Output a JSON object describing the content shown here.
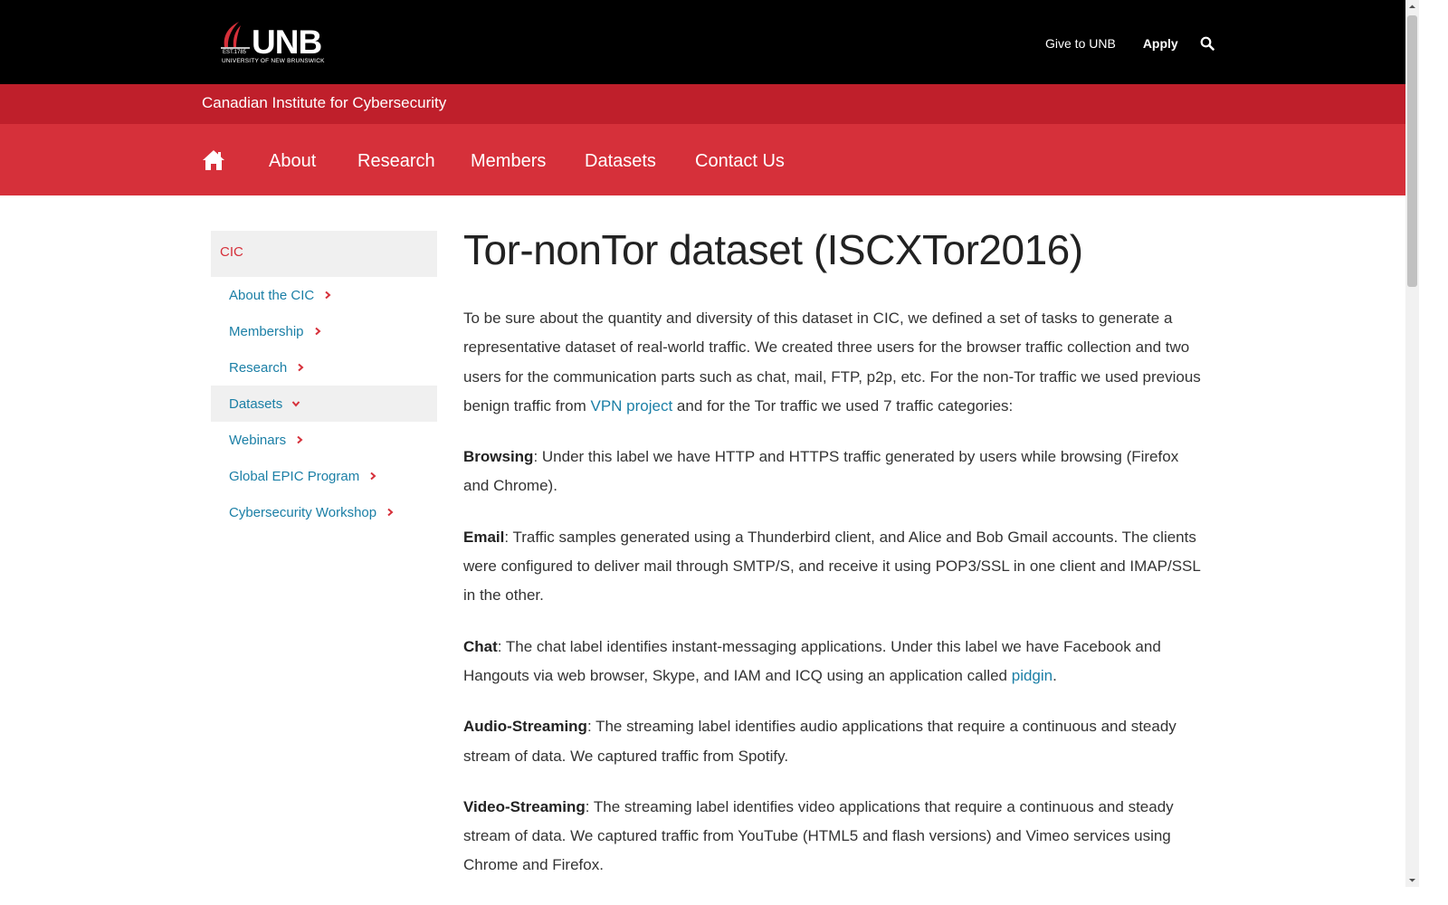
{
  "header": {
    "logo_text": "UNB",
    "logo_est": "EST.1785",
    "logo_sub": "UNIVERSITY OF NEW BRUNSWICK",
    "links": {
      "give": "Give to UNB",
      "apply": "Apply"
    }
  },
  "site": {
    "title": "Canadian Institute for Cybersecurity"
  },
  "nav": {
    "items": [
      {
        "label": "About"
      },
      {
        "label": "Research"
      },
      {
        "label": "Members"
      },
      {
        "label": "Datasets"
      },
      {
        "label": "Contact Us"
      }
    ]
  },
  "sidebar": {
    "heading": "CIC",
    "items": [
      {
        "label": "About the CIC"
      },
      {
        "label": "Membership"
      },
      {
        "label": "Research"
      },
      {
        "label": "Datasets"
      },
      {
        "label": "Webinars"
      },
      {
        "label": "Global EPIC Program"
      },
      {
        "label": "Cybersecurity Workshop"
      }
    ]
  },
  "main": {
    "title": "Tor-nonTor dataset (ISCXTor2016)",
    "intro_a": "To be sure about the quantity and diversity of this dataset in CIC, we defined a set of tasks to generate a representative dataset of real-world traffic. We created three users for the browser traffic collection and two users for the communication parts such as chat, mail, FTP, p2p, etc. For the non-Tor traffic we used previous benign traffic from ",
    "intro_link": "VPN project",
    "intro_b": " and for the Tor traffic we used 7 traffic categories:",
    "browsing_label": "Browsing",
    "browsing_text": ": Under this label we have HTTP and HTTPS traffic generated by users while browsing (Firefox and Chrome).",
    "email_label": "Email",
    "email_text": ": Traffic samples generated using a Thunderbird client, and Alice and Bob Gmail accounts. The clients were configured to deliver mail through SMTP/S, and receive it using POP3/SSL in one client and IMAP/SSL in the other.",
    "chat_label": "Chat",
    "chat_text": ": The chat label identifies instant-messaging applications. Under this label we have Facebook and Hangouts via web browser, Skype, and IAM and ICQ using an application called ",
    "chat_link": "pidgin",
    "chat_end": ".",
    "audio_label": "Audio-Streaming",
    "audio_text": ": The streaming label identifies audio applications that require a continuous and steady stream of data. We captured traffic from Spotify.",
    "video_label": "Video-Streaming",
    "video_text": ": The streaming label identifies video applications that require a continuous and steady stream of data. We captured traffic from YouTube (HTML5 and flash versions) and Vimeo services using Chrome and Firefox."
  }
}
